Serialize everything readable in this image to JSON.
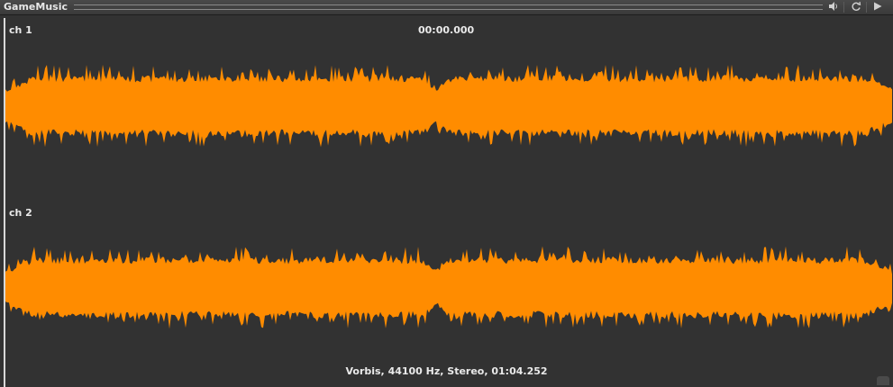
{
  "window": {
    "title": "GameMusic"
  },
  "titlebar_buttons": [
    {
      "name": "volume-icon",
      "glyph": "🔈"
    },
    {
      "name": "loop-icon",
      "glyph": "⟳"
    },
    {
      "name": "play-icon",
      "glyph": "▶"
    }
  ],
  "channels": [
    {
      "label": "ch 1"
    },
    {
      "label": "ch 2"
    }
  ],
  "playback": {
    "position": "00:00.000"
  },
  "file_info": "Vorbis, 44100 Hz, Stereo, 01:04.252",
  "colors": {
    "waveform": "#ff8c00",
    "background": "#323232"
  }
}
